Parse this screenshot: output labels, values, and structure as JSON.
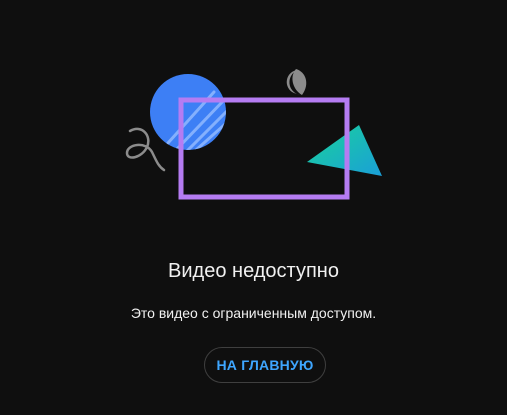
{
  "error": {
    "title": "Видео недоступно",
    "message": "Это видео с ограниченным доступом.",
    "home_button_label": "НА ГЛАВНУЮ"
  },
  "colors": {
    "background": "#0f0f0f",
    "circle": "#3d7ff5",
    "frame": "#b57cf2",
    "triangle": "#0fb8a0",
    "half_moon": "#8c8c8c",
    "squiggle": "#8c8c8c",
    "button_text": "#3ea6ff"
  },
  "icons": [
    "blue-circle-shape",
    "purple-frame-shape",
    "teal-triangle-shape",
    "half-moon-shape",
    "squiggle-shape"
  ]
}
